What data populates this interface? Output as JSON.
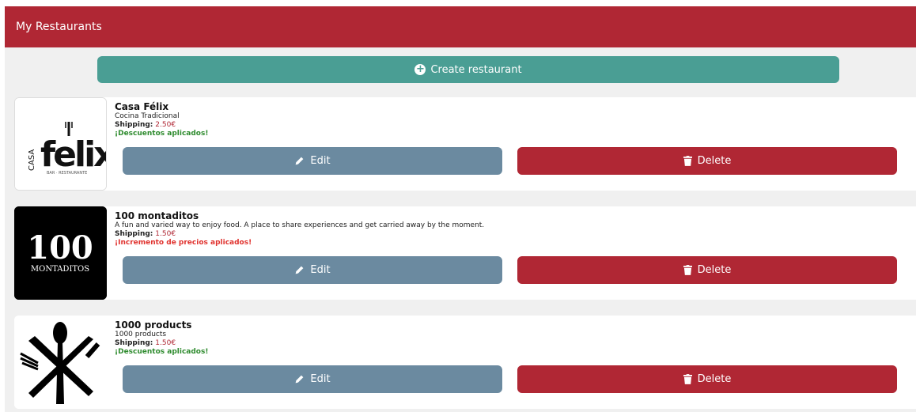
{
  "header": {
    "title": "My Restaurants"
  },
  "create_button": {
    "label": "Create restaurant",
    "icon": "plus-circle-icon"
  },
  "colors": {
    "brand": "#b02734",
    "create": "#4a9e94",
    "edit": "#6b8aa0",
    "discount": "#2e8b2e",
    "increase": "#e0332f"
  },
  "restaurants": [
    {
      "name": "Casa Félix",
      "description": "Cocina Tradicional",
      "shipping_label": "Shipping:",
      "shipping_value": "2.50€",
      "promo": "¡Descuentos aplicados!",
      "promo_type": "discount",
      "logo": {
        "vertical_text": "CASA",
        "main_text": "felix",
        "sub_text": "BAR · RESTAURANTE"
      },
      "edit_label": "Edit",
      "delete_label": "Delete"
    },
    {
      "name": "100 montaditos",
      "description": "A fun and varied way to enjoy food. A place to share experiences and get carried away by the moment.",
      "shipping_label": "Shipping:",
      "shipping_value": "1.50€",
      "promo": "¡Incremento de precios aplicados!",
      "promo_type": "increase",
      "logo": {
        "main_text": "100",
        "sub_text": "MONTADITOS"
      },
      "edit_label": "Edit",
      "delete_label": "Delete"
    },
    {
      "name": "1000 products",
      "description": "1000 products",
      "shipping_label": "Shipping:",
      "shipping_value": "1.50€",
      "promo": "¡Descuentos aplicados!",
      "promo_type": "discount",
      "logo": {
        "icon": "cutlery-cross-icon"
      },
      "edit_label": "Edit",
      "delete_label": "Delete"
    }
  ]
}
